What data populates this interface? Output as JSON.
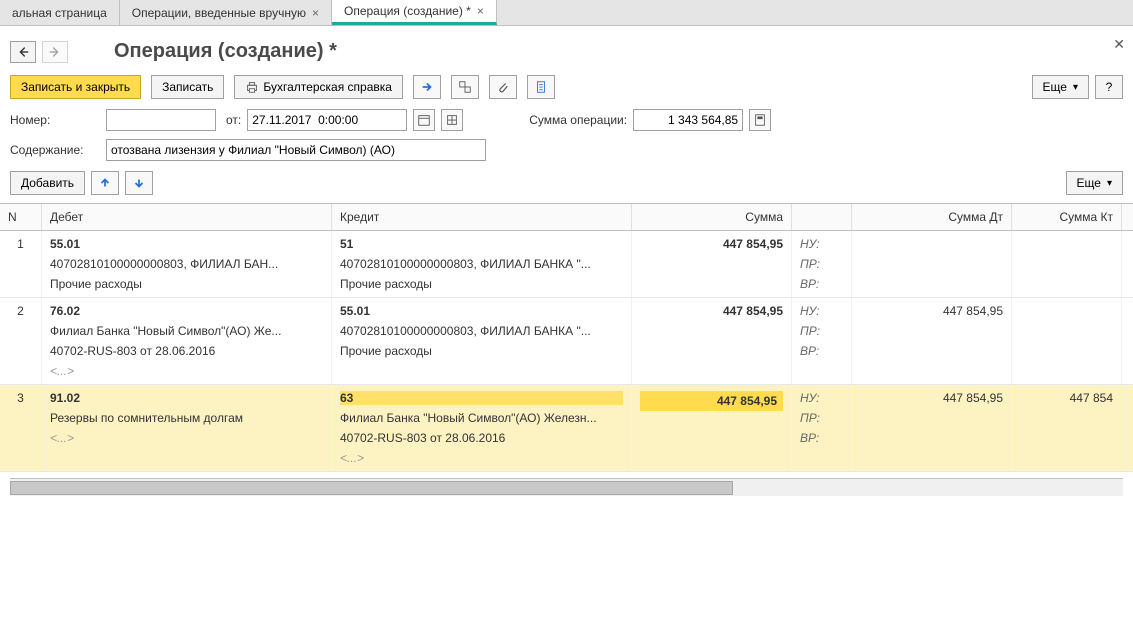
{
  "tabs": [
    {
      "label": "альная страница",
      "closable": false,
      "active": false
    },
    {
      "label": "Операции, введенные вручную",
      "closable": true,
      "active": false
    },
    {
      "label": "Операция (создание) *",
      "closable": true,
      "active": true
    }
  ],
  "page": {
    "title": "Операция (создание) *"
  },
  "toolbar": {
    "save_close": "Записать и закрыть",
    "save": "Записать",
    "acct_doc": "Бухгалтерская справка",
    "more": "Еще",
    "help": "?"
  },
  "form": {
    "number_label": "Номер:",
    "number_value": "",
    "from_label": "от:",
    "date_value": "27.11.2017  0:00:00",
    "sum_label": "Сумма операции:",
    "sum_value": "1 343 564,85",
    "content_label": "Содержание:",
    "content_value": "отозвана лизензия у Филиал \"Новый Символ) (АО)"
  },
  "table_toolbar": {
    "add": "Добавить",
    "more": "Еще"
  },
  "columns": {
    "n": "N",
    "debit": "Дебет",
    "credit": "Кредит",
    "sum": "Сумма",
    "sum_dt": "Сумма Дт",
    "sum_kt": "Сумма Кт"
  },
  "rows": [
    {
      "n": "1",
      "debit_top": "55.01",
      "debit_lines": [
        "40702810100000000803, ФИЛИАЛ БАН...",
        "Прочие расходы"
      ],
      "credit_top": "51",
      "credit_lines": [
        "40702810100000000803, ФИЛИАЛ БАНКА \"...",
        "Прочие расходы"
      ],
      "sum": "447 854,95",
      "tax_labels": [
        "НУ:",
        "ПР:",
        "ВР:"
      ],
      "sum_dt": "",
      "sum_kt": "",
      "selected": false
    },
    {
      "n": "2",
      "debit_top": "76.02",
      "debit_lines": [
        "Филиал Банка \"Новый Символ\"(АО) Же...",
        "40702-RUS-803 от 28.06.2016",
        "<...>"
      ],
      "credit_top": "55.01",
      "credit_lines": [
        "40702810100000000803, ФИЛИАЛ БАНКА \"...",
        "Прочие расходы"
      ],
      "sum": "447 854,95",
      "tax_labels": [
        "НУ:",
        "ПР:",
        "ВР:"
      ],
      "sum_dt": "447 854,95",
      "sum_kt": "",
      "selected": false
    },
    {
      "n": "3",
      "debit_top": "91.02",
      "debit_lines": [
        "Резервы по сомнительным долгам",
        "<...>"
      ],
      "credit_top": "63",
      "credit_lines": [
        "Филиал Банка \"Новый Символ\"(АО) Железн...",
        "40702-RUS-803 от 28.06.2016",
        "<...>"
      ],
      "sum": "447 854,95",
      "tax_labels": [
        "НУ:",
        "ПР:",
        "ВР:"
      ],
      "sum_dt": "447 854,95",
      "sum_kt": "447 854",
      "selected": true
    }
  ]
}
